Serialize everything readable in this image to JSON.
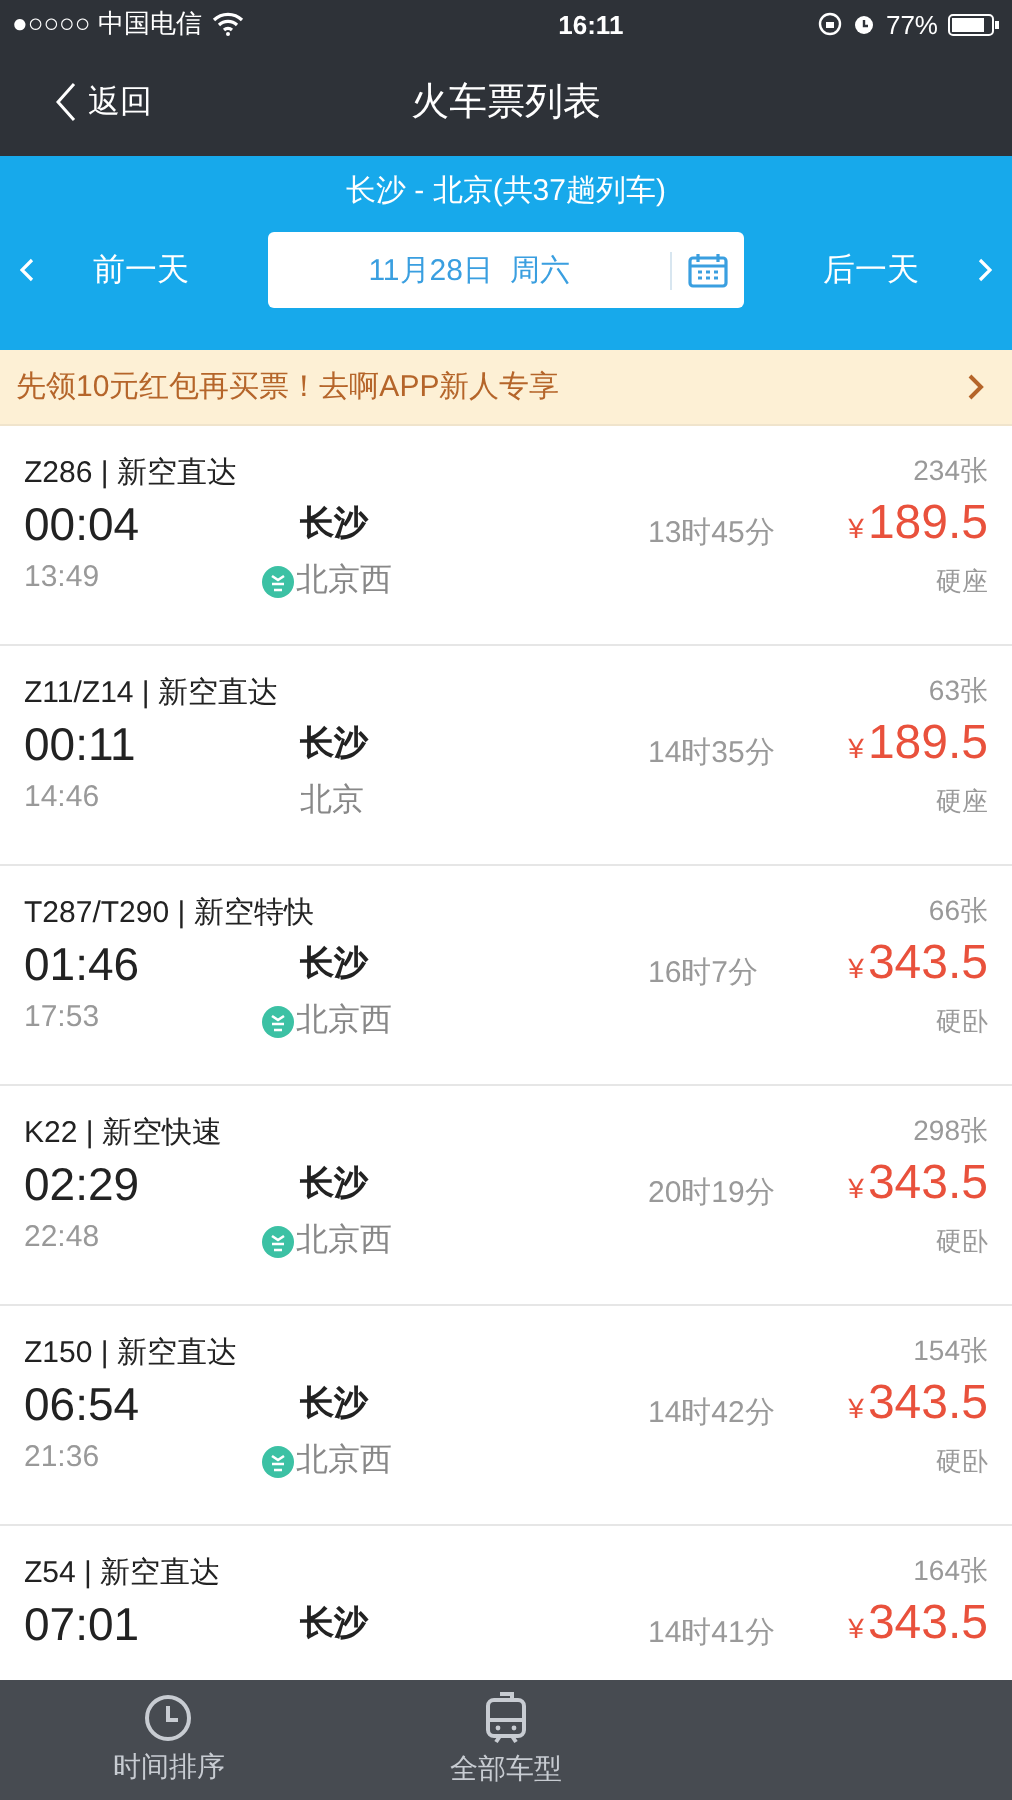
{
  "status_bar": {
    "carrier": "●○○○○ 中国电信",
    "time": "16:11",
    "battery": "77%"
  },
  "nav": {
    "back": "返回",
    "title": "火车票列表"
  },
  "route": "长沙 - 北京(共37趟列车)",
  "date_bar": {
    "prev": "前一天",
    "date": "11月28日  周六",
    "next": "后一天"
  },
  "promo": "先领10元红包再买票！去啊APP新人专享",
  "trains": [
    {
      "train": "Z286 | 新空直达",
      "depart": "00:04",
      "from": "长沙",
      "arrive": "13:49",
      "to": "北京西",
      "terminal": true,
      "duration": "13时45分",
      "currency": "¥",
      "price": "189.5",
      "tickets": "234张",
      "seat": "硬座"
    },
    {
      "train": "Z11/Z14 | 新空直达",
      "depart": "00:11",
      "from": "长沙",
      "arrive": "14:46",
      "to": "北京",
      "terminal": false,
      "duration": "14时35分",
      "currency": "¥",
      "price": "189.5",
      "tickets": "63张",
      "seat": "硬座"
    },
    {
      "train": "T287/T290 | 新空特快",
      "depart": "01:46",
      "from": "长沙",
      "arrive": "17:53",
      "to": "北京西",
      "terminal": true,
      "duration": "16时7分",
      "currency": "¥",
      "price": "343.5",
      "tickets": "66张",
      "seat": "硬卧"
    },
    {
      "train": "K22 | 新空快速",
      "depart": "02:29",
      "from": "长沙",
      "arrive": "22:48",
      "to": "北京西",
      "terminal": true,
      "duration": "20时19分",
      "currency": "¥",
      "price": "343.5",
      "tickets": "298张",
      "seat": "硬卧"
    },
    {
      "train": "Z150 | 新空直达",
      "depart": "06:54",
      "from": "长沙",
      "arrive": "21:36",
      "to": "北京西",
      "terminal": true,
      "duration": "14时42分",
      "currency": "¥",
      "price": "343.5",
      "tickets": "154张",
      "seat": "硬卧"
    },
    {
      "train": "Z54 | 新空直达",
      "depart": "07:01",
      "from": "长沙",
      "duration": "14时41分",
      "currency": "¥",
      "price": "343.5",
      "tickets": "164张"
    }
  ],
  "tab_bar": [
    {
      "kind": "clock",
      "label": "时间排序"
    },
    {
      "kind": "train",
      "label": "全部车型"
    }
  ]
}
